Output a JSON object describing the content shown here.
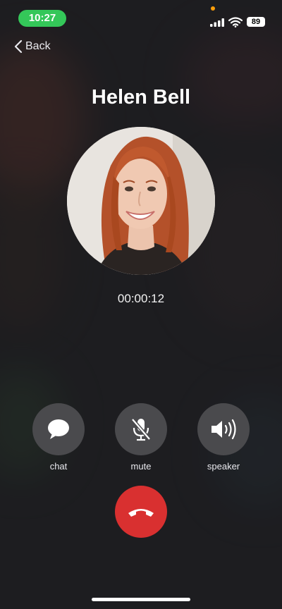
{
  "status_bar": {
    "time": "10:27",
    "battery": "89",
    "accent_green": "#34c759",
    "mic_indicator_color": "#ff9f0a",
    "icons": [
      "signal-icon",
      "wifi-icon",
      "battery-icon"
    ]
  },
  "nav": {
    "back_label": "Back",
    "back_icon": "chevron-left-icon"
  },
  "call": {
    "caller_name": "Helen Bell",
    "duration": "00:00:12"
  },
  "controls": [
    {
      "label": "chat",
      "icon": "chat-bubble-icon"
    },
    {
      "label": "mute",
      "icon": "mic-off-icon"
    },
    {
      "label": "speaker",
      "icon": "speaker-icon"
    }
  ],
  "end_call": {
    "icon": "phone-hangup-icon",
    "color": "#d93030"
  }
}
